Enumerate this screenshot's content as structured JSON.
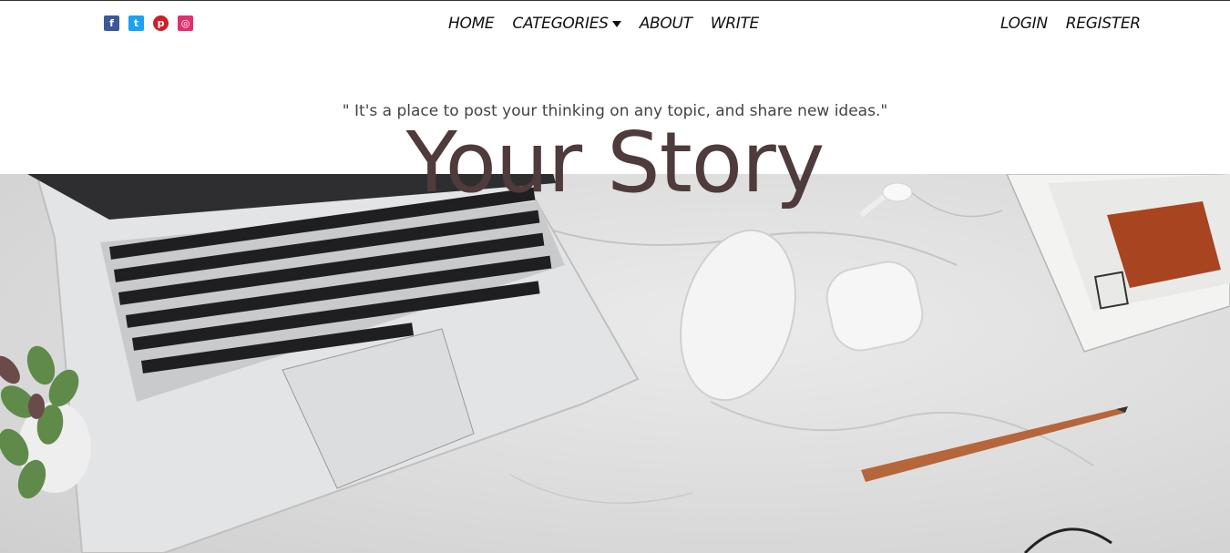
{
  "social": [
    {
      "icon": "facebook-icon",
      "glyph": "f",
      "color": "#3b5998"
    },
    {
      "icon": "twitter-icon",
      "glyph": "t",
      "color": "#1da1f2"
    },
    {
      "icon": "pinterest-icon",
      "glyph": "p",
      "color": "#cb2027"
    },
    {
      "icon": "instagram-icon",
      "glyph": "◎",
      "color": "#e1306c"
    }
  ],
  "nav": {
    "home": "HOME",
    "categories": "CATEGORIES",
    "about": "ABOUT",
    "write": "WRITE",
    "login": "LOGIN",
    "register": "REGISTER"
  },
  "header": {
    "tagline": "\" It's a place to post your thinking on any topic, and share new ideas.\"",
    "title": "Your Story"
  },
  "colors": {
    "title": "#4f3a3c"
  }
}
